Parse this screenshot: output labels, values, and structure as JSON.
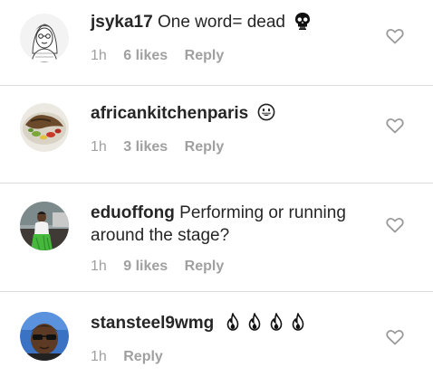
{
  "comments": [
    {
      "username": "jsyka17",
      "text": "One word= dead",
      "emoji_icon": "skull-icon",
      "time": "1h",
      "likes": "6 likes",
      "reply": "Reply"
    },
    {
      "username": "africankitchenparis",
      "text": "",
      "emoji_icon": "grinning-face-icon",
      "time": "1h",
      "likes": "3 likes",
      "reply": "Reply"
    },
    {
      "username": "eduoffong",
      "text": "Performing or running around the stage?",
      "time": "1h",
      "likes": "9 likes",
      "reply": "Reply"
    },
    {
      "username": "stansteel9wmg",
      "text": "",
      "emoji_icon": "fire-icon",
      "emoji_count": 4,
      "time": "1h",
      "reply": "Reply"
    }
  ],
  "colors": {
    "text": "#262626",
    "meta": "#a0a0a0",
    "divider": "#dbdbdb",
    "heart_outline": "#9a9a9a"
  }
}
